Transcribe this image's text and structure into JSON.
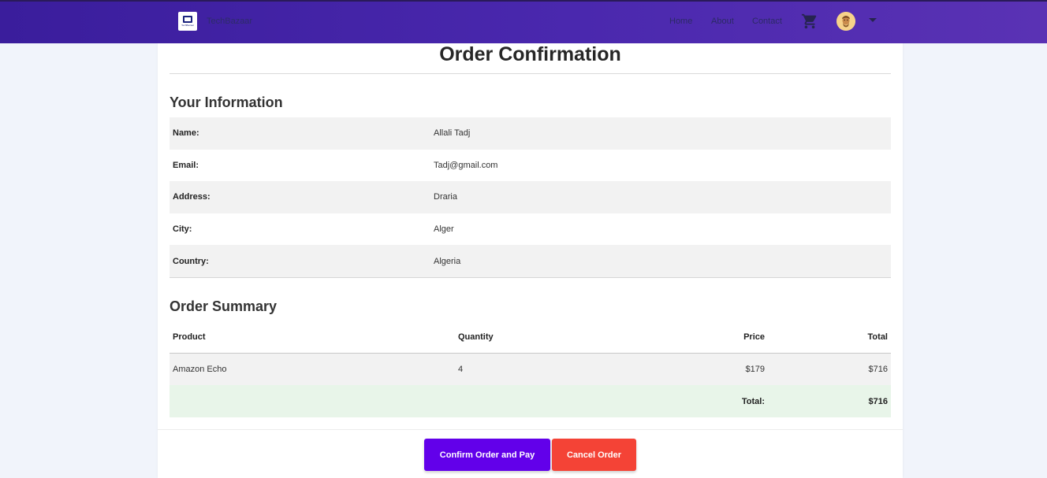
{
  "navbar": {
    "brand": "TechBazaar",
    "logo_text": "TechBazaar",
    "links": [
      "Home",
      "About",
      "Contact"
    ],
    "icons": [
      "cart-icon",
      "avatar",
      "chevron-down-icon"
    ]
  },
  "page": {
    "title": "Order Confirmation"
  },
  "your_information": {
    "heading": "Your Information",
    "rows": [
      {
        "label": "Name:",
        "value": "Allali Tadj"
      },
      {
        "label": "Email:",
        "value": "Tadj@gmail.com"
      },
      {
        "label": "Address:",
        "value": "Draria"
      },
      {
        "label": "City:",
        "value": "Alger"
      },
      {
        "label": "Country:",
        "value": "Algeria"
      }
    ]
  },
  "order_summary": {
    "heading": "Order Summary",
    "columns": [
      "Product",
      "Quantity",
      "Price",
      "Total"
    ],
    "items": [
      {
        "product": "Amazon Echo",
        "quantity": "4",
        "price": "$179",
        "total": "$716"
      }
    ],
    "total_label": "Total:",
    "total_value": "$716"
  },
  "actions": {
    "confirm_label": "Confirm Order and Pay",
    "cancel_label": "Cancel Order"
  },
  "colors": {
    "navbar_start": "#3a1d9c",
    "navbar_end": "#5a32b4",
    "confirm_button": "#6200ea",
    "cancel_button": "#f44336",
    "total_row": "#e8f5e9"
  }
}
